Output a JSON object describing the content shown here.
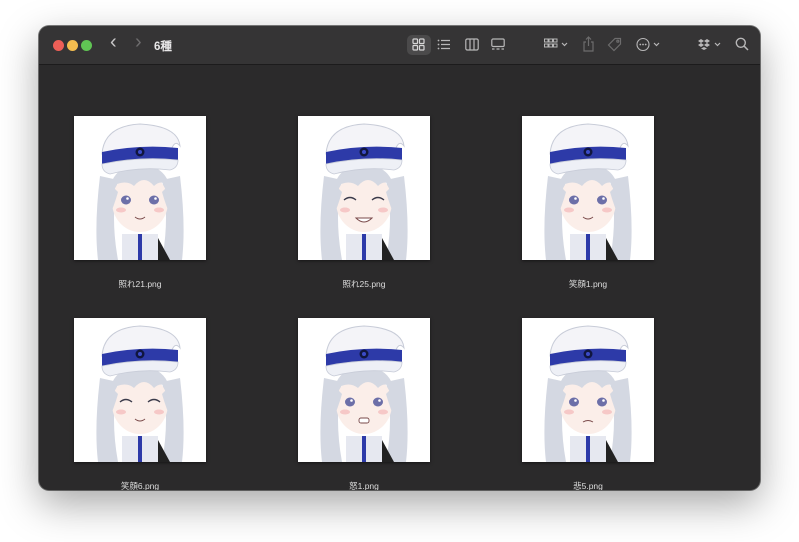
{
  "window": {
    "title": "6種"
  },
  "toolbar": {
    "back_glyph": "‹",
    "forward_glyph": "›",
    "icons": [
      "icon-view-icon",
      "list-view-icon",
      "column-view-icon",
      "gallery-view-icon",
      "group-icon",
      "share-icon",
      "tag-icon",
      "more-icon",
      "dropbox-icon",
      "search-icon"
    ]
  },
  "files": [
    {
      "name": "照れ21.png",
      "expression": "blush-smile"
    },
    {
      "name": "照れ25.png",
      "expression": "grin-wink"
    },
    {
      "name": "笑顔1.png",
      "expression": "smile"
    },
    {
      "name": "笑顔6.png",
      "expression": "closed-eye-smile"
    },
    {
      "name": "怒1.png",
      "expression": "angry"
    },
    {
      "name": "悲5.png",
      "expression": "sad"
    }
  ],
  "colors": {
    "window_bg": "#2b2a2b",
    "hat_band": "#2d3aa8",
    "hair": "#d4d8e2"
  }
}
